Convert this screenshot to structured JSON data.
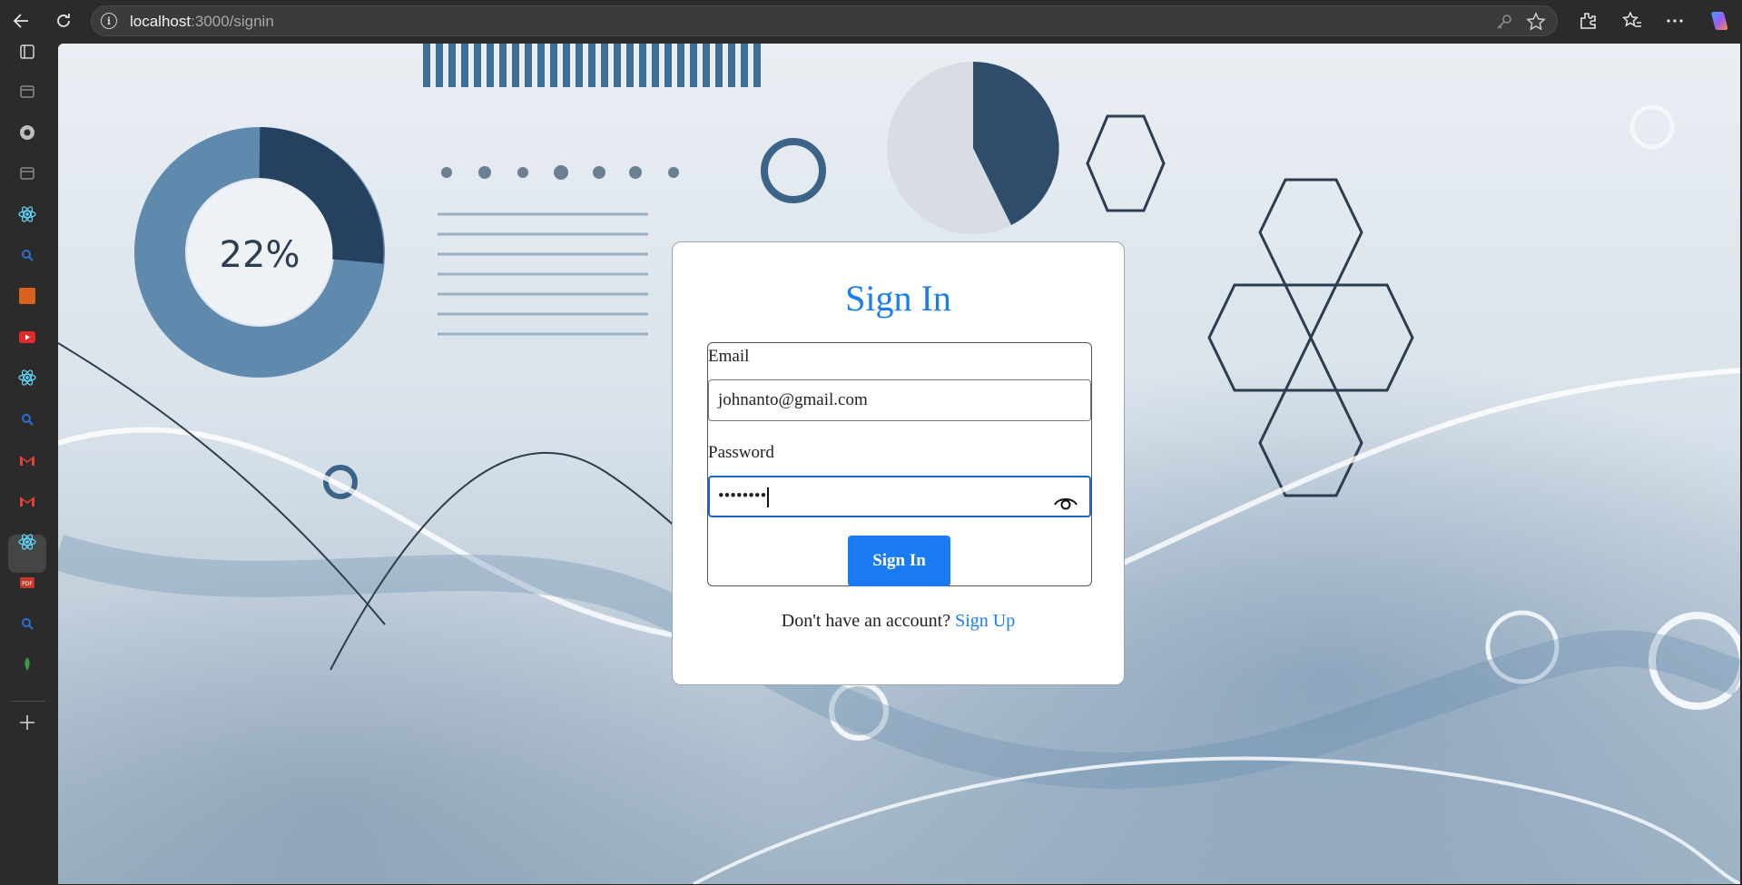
{
  "browser": {
    "url_host": "localhost",
    "url_rest": ":3000/signin",
    "icons": [
      "back-icon",
      "reload-icon",
      "info-icon",
      "key-icon",
      "favorite-star-icon",
      "extensions-icon",
      "favorites-icon",
      "more-icon",
      "copilot-icon"
    ]
  },
  "sidebar": {
    "items": [
      {
        "name": "tab-actions-icon",
        "color": "#d6d6d6"
      },
      {
        "name": "tab-page-icon",
        "color": "#8a8a8a"
      },
      {
        "name": "tab-chrome-icon",
        "color": "#bfbfbf"
      },
      {
        "name": "tab-page-icon",
        "color": "#8a8a8a"
      },
      {
        "name": "tab-react-icon",
        "color": "#5ed3f3"
      },
      {
        "name": "tab-search-icon",
        "color": "#2f6fd0"
      },
      {
        "name": "tab-orange-icon",
        "color": "#d9631e"
      },
      {
        "name": "tab-youtube-icon",
        "color": "#e02b2b"
      },
      {
        "name": "tab-react-icon",
        "color": "#5ed3f3"
      },
      {
        "name": "tab-search-icon",
        "color": "#2f6fd0"
      },
      {
        "name": "tab-gmail-icon",
        "color": "#e34133"
      },
      {
        "name": "tab-gmail-icon",
        "color": "#e34133"
      },
      {
        "name": "tab-react-icon",
        "color": "#5ed3f3"
      },
      {
        "name": "tab-pdf-icon",
        "color": "#c0392b"
      },
      {
        "name": "tab-search-icon",
        "color": "#2f6fd0"
      },
      {
        "name": "tab-mongodb-icon",
        "color": "#3d9b45"
      }
    ],
    "new_tab_icon": "plus-icon"
  },
  "signin": {
    "title": "Sign In",
    "email_label": "Email",
    "email_value": "johnanto@gmail.com",
    "password_label": "Password",
    "password_value": "••••••••",
    "button_label": "Sign In",
    "footer_text": "Don't have an account?",
    "footer_link": "Sign Up"
  },
  "colors": {
    "accent": "#1a7cf0",
    "focus_border": "#1a66c8"
  }
}
